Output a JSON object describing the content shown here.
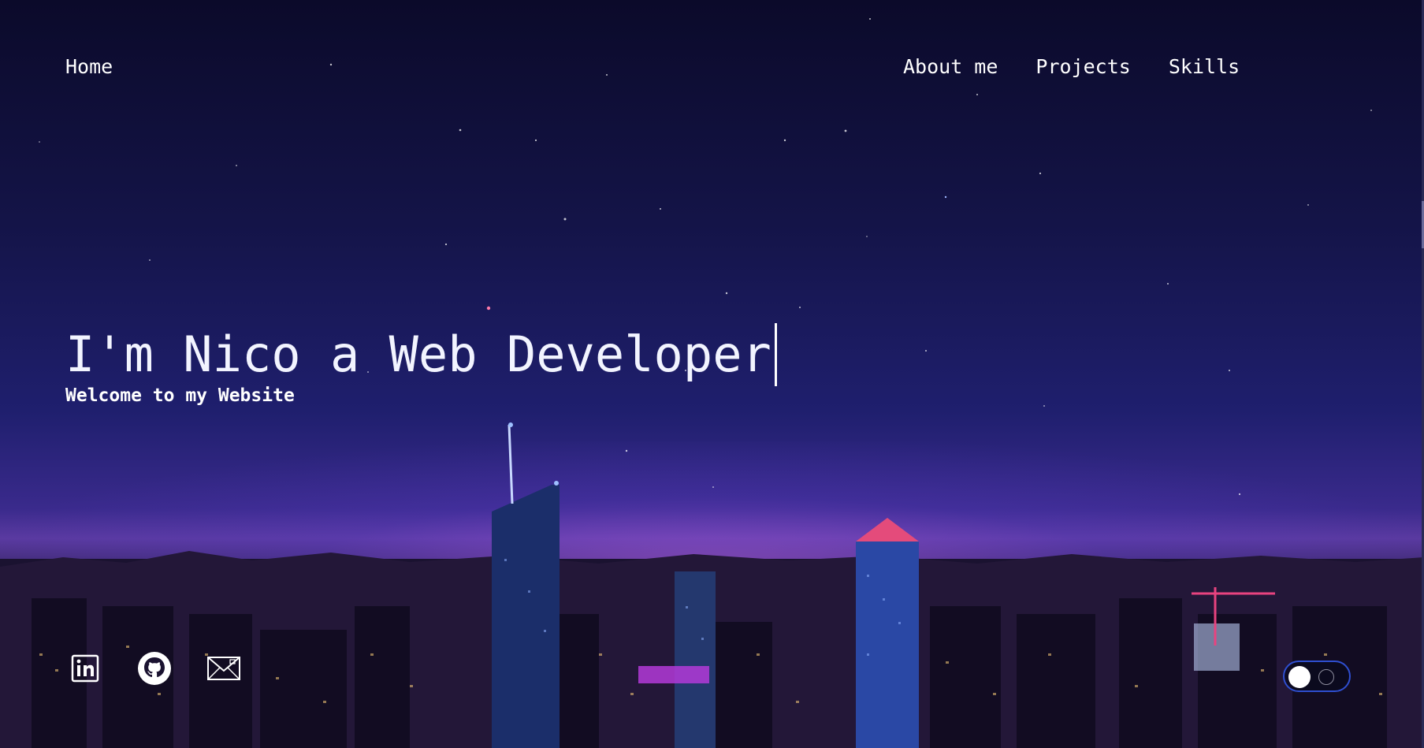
{
  "nav": {
    "home_label": "Home",
    "links": [
      {
        "label": "About me"
      },
      {
        "label": "Projects"
      },
      {
        "label": "Skills"
      }
    ]
  },
  "hero": {
    "title": "I'm Nico a Web Developer",
    "subtitle": "Welcome to my Website"
  },
  "socials": [
    {
      "icon": "linkedin-icon"
    },
    {
      "icon": "github-icon"
    },
    {
      "icon": "mail-icon"
    }
  ],
  "theme_toggle": {
    "state": "on"
  },
  "colors": {
    "text": "#ffffff",
    "sky_top": "#0b0a2a",
    "sky_horizon": "#5a3aa0",
    "toggle_border": "#2f4fd0"
  }
}
